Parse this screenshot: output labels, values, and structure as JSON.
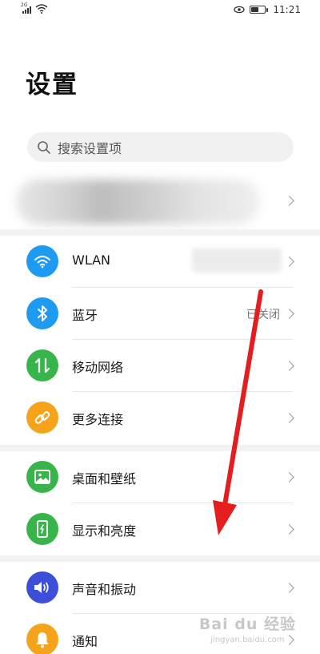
{
  "status_bar": {
    "network_label": "2G",
    "time": "11:21",
    "battery_level": 0.6,
    "icons": [
      "signal-icon",
      "wifi-icon",
      "eye-comfort-icon",
      "battery-icon"
    ]
  },
  "page_title": "设置",
  "search": {
    "placeholder": "搜索设置项"
  },
  "items": [
    {
      "label": "WLAN",
      "value": "",
      "icon": "wifi-icon",
      "color": "#1e9bf0"
    },
    {
      "label": "蓝牙",
      "value": "已关闭",
      "icon": "bluetooth-icon",
      "color": "#1e9bf0"
    },
    {
      "label": "移动网络",
      "value": "",
      "icon": "mobile-data-icon",
      "color": "#37b54a"
    },
    {
      "label": "更多连接",
      "value": "",
      "icon": "link-icon",
      "color": "#f5a31a"
    },
    {
      "label": "桌面和壁纸",
      "value": "",
      "icon": "picture-icon",
      "color": "#37b54a"
    },
    {
      "label": "显示和亮度",
      "value": "",
      "icon": "display-icon",
      "color": "#37b54a"
    },
    {
      "label": "声音和振动",
      "value": "",
      "icon": "sound-icon",
      "color": "#3d4fd9"
    },
    {
      "label": "通知",
      "value": "",
      "icon": "bell-icon",
      "color": "#f5a31a"
    }
  ],
  "watermark": {
    "brand": "Bai du 经验",
    "url": "jingyan.baidu.com"
  },
  "annotation": {
    "color": "#e41e1e"
  }
}
